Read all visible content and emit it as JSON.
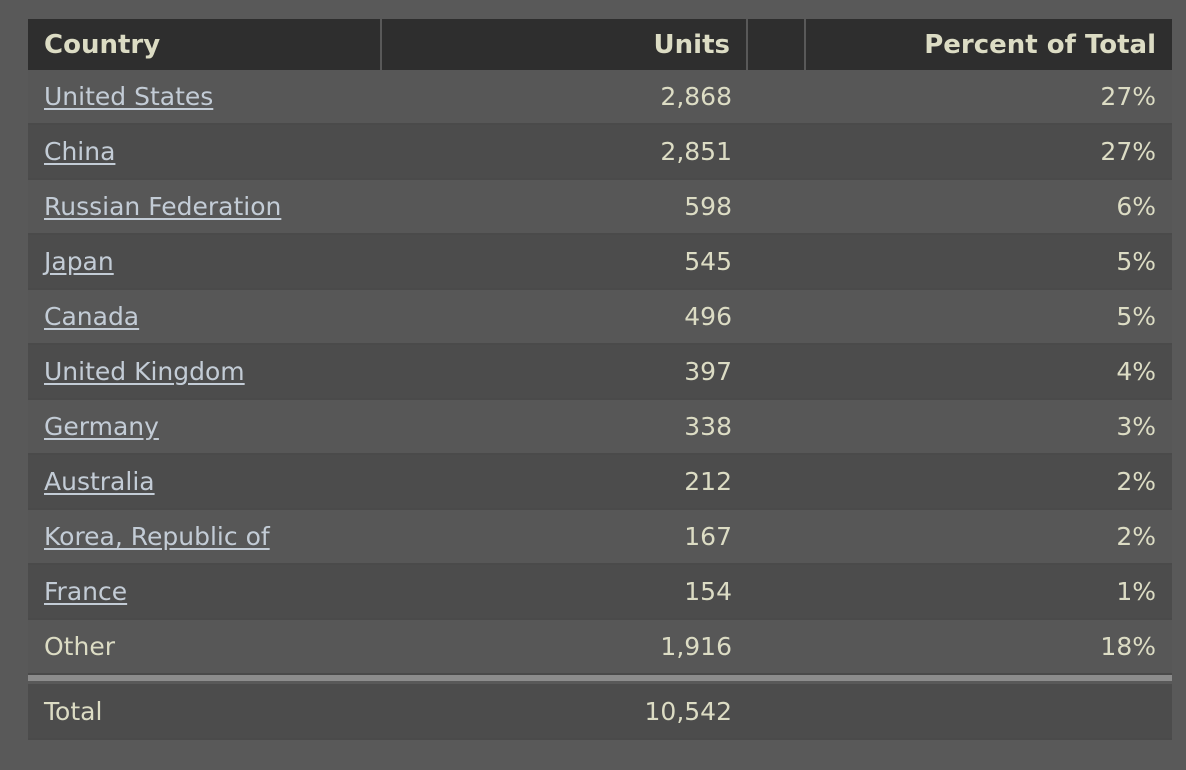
{
  "table": {
    "columns": [
      {
        "key": "country",
        "label": "Country",
        "align": "left"
      },
      {
        "key": "units",
        "label": "Units",
        "align": "right"
      },
      {
        "key": "spacer",
        "label": "",
        "align": "center"
      },
      {
        "key": "percent",
        "label": "Percent of Total",
        "align": "right"
      }
    ],
    "rows": [
      {
        "country": "United States",
        "units": "2,868",
        "percent": "27%",
        "is_link": true
      },
      {
        "country": "China",
        "units": "2,851",
        "percent": "27%",
        "is_link": true
      },
      {
        "country": "Russian Federation",
        "units": "598",
        "percent": "6%",
        "is_link": true
      },
      {
        "country": "Japan",
        "units": "545",
        "percent": "5%",
        "is_link": true
      },
      {
        "country": "Canada",
        "units": "496",
        "percent": "5%",
        "is_link": true
      },
      {
        "country": "United Kingdom",
        "units": "397",
        "percent": "4%",
        "is_link": true
      },
      {
        "country": "Germany",
        "units": "338",
        "percent": "3%",
        "is_link": true
      },
      {
        "country": "Australia",
        "units": "212",
        "percent": "2%",
        "is_link": true
      },
      {
        "country": "Korea, Republic of",
        "units": "167",
        "percent": "2%",
        "is_link": true
      },
      {
        "country": "France",
        "units": "154",
        "percent": "1%",
        "is_link": true
      },
      {
        "country": "Other",
        "units": "1,916",
        "percent": "18%",
        "is_link": false
      }
    ],
    "total": {
      "label": "Total",
      "units": "10,542",
      "percent": ""
    }
  },
  "colors": {
    "page_background": "#595959",
    "header_background": "#2e2e2e",
    "header_text": "#dcdcc4",
    "row_odd_background": "#575757",
    "row_even_background": "#4c4c4c",
    "value_text": "#dcdcc4",
    "link_text": "#c3ccd6",
    "separator": "#8c8c8c",
    "total_background": "#4c4c4c"
  },
  "chart_data": {
    "type": "table",
    "title": "",
    "columns": [
      "Country",
      "Units",
      "",
      "Percent of Total"
    ],
    "categories": [
      "United States",
      "China",
      "Russian Federation",
      "Japan",
      "Canada",
      "United Kingdom",
      "Germany",
      "Australia",
      "Korea, Republic of",
      "France",
      "Other"
    ],
    "series": [
      {
        "name": "Units",
        "values": [
          2868,
          2851,
          598,
          545,
          496,
          397,
          338,
          212,
          167,
          154,
          1916
        ]
      },
      {
        "name": "Percent of Total",
        "values": [
          27,
          27,
          6,
          5,
          5,
          4,
          3,
          2,
          2,
          1,
          18
        ]
      }
    ],
    "total_units": 10542,
    "xlabel": "Country",
    "ylabel": "Units"
  }
}
